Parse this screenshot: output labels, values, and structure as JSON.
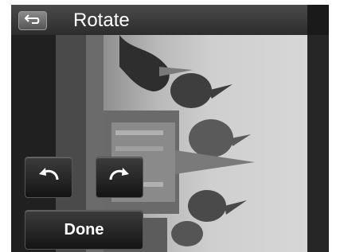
{
  "header": {
    "title": "Rotate",
    "back_icon": "back-arrow-icon"
  },
  "controls": {
    "rotate_left_icon": "rotate-counterclockwise-icon",
    "rotate_right_icon": "rotate-clockwise-icon",
    "done_label": "Done"
  },
  "colors": {
    "background": "#1e1e1e",
    "text": "#ffffff"
  }
}
